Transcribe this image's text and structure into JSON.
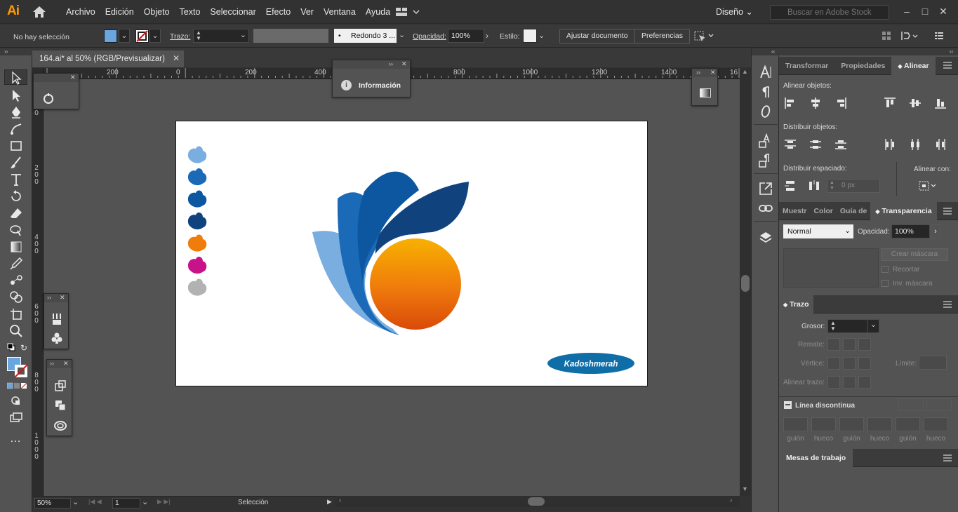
{
  "app": {
    "logo": "Ai"
  },
  "menu": [
    "Archivo",
    "Edición",
    "Objeto",
    "Texto",
    "Seleccionar",
    "Efecto",
    "Ver",
    "Ventana",
    "Ayuda"
  ],
  "workspace": "Diseño",
  "search": {
    "placeholder": "Buscar en Adobe Stock"
  },
  "control": {
    "selection": "No hay selección",
    "stroke_label": "Trazo:",
    "brush": "Redondo 3 ...",
    "opacity_label": "Opacidad:",
    "opacity_value": "100%",
    "style_label": "Estilo:",
    "adjust_doc": "Ajustar documento",
    "preferences": "Preferencias",
    "fill_color": "#6aa6de"
  },
  "document": {
    "tab_title": "164.ai* al 50% (RGB/Previsualizar)"
  },
  "rulers": {
    "top": [
      "200",
      "0",
      "200",
      "400",
      "600",
      "800",
      "1000",
      "1200",
      "1400",
      "16"
    ],
    "left": [
      [
        "0"
      ],
      [
        "2",
        "0",
        "0"
      ],
      [
        "4",
        "0",
        "0"
      ],
      [
        "6",
        "0",
        "0"
      ],
      [
        "8",
        "0",
        "0"
      ],
      [
        "1",
        "0",
        "0",
        "0"
      ]
    ]
  },
  "info_panel": {
    "title": "Información"
  },
  "artwork": {
    "swatches": [
      "#7aaee0",
      "#1a6ab8",
      "#0d56a0",
      "#10437e",
      "#ef7d0b",
      "#c8128a",
      "#b2b2b2"
    ],
    "logo_text": "Kadoshmerah",
    "badge_color": "#0f6ea8"
  },
  "status": {
    "zoom": "50%",
    "artboard": "1",
    "tool": "Selección"
  },
  "right": {
    "tabs_top": [
      "Transformar",
      "Propiedades",
      "Alinear"
    ],
    "align_objects": "Alinear objetos:",
    "distribute_objects": "Distribuir objetos:",
    "distribute_spacing": "Distribuir espaciado:",
    "align_to": "Alinear con:",
    "spacing_value": "0 px",
    "tabs_mid": [
      "Muestr",
      "Color",
      "Guía de",
      "Transparencia"
    ],
    "blend_mode": "Normal",
    "opacity_label": "Opacidad:",
    "opacity_value": "100%",
    "make_mask": "Crear máscara",
    "clip": "Recortar",
    "invert_mask": "Inv. máscara",
    "stroke_tab": "Trazo",
    "weight_label": "Grosor:",
    "cap_label": "Remate:",
    "corner_label": "Vértice:",
    "limit_label": "Límite:",
    "align_stroke_label": "Alinear trazo:",
    "dashed_label": "Línea discontinua",
    "dash_labels": [
      "guión",
      "hueco",
      "guión",
      "hueco",
      "guión",
      "hueco"
    ],
    "artboards_tab": "Mesas de trabajo"
  }
}
